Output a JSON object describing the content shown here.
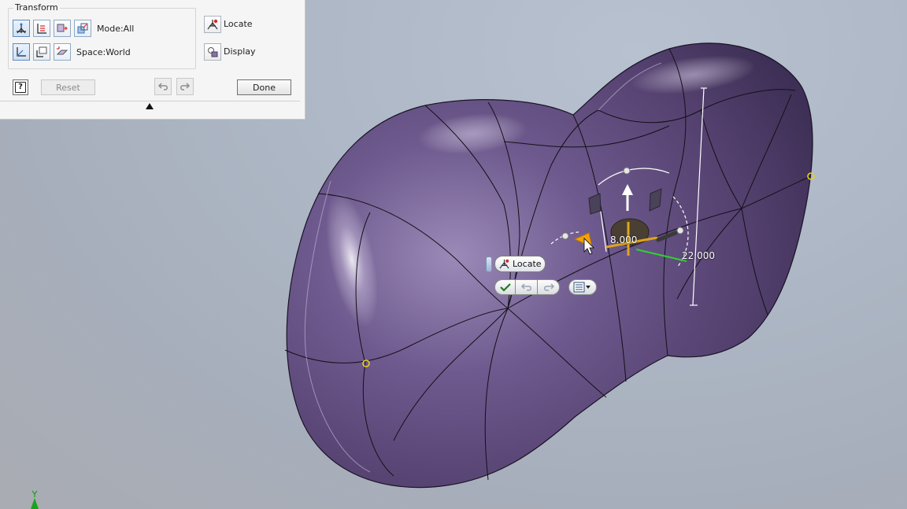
{
  "panel": {
    "group_title": "Transform",
    "mode_label": "Mode:All",
    "space_label": "Space:World",
    "locate_label": "Locate",
    "display_label": "Display",
    "reset_label": "Reset",
    "done_label": "Done",
    "icons": {
      "row1": [
        "transform-all-icon",
        "transform-axis-icon",
        "transform-planar-icon",
        "transform-scale-icon"
      ],
      "row2": [
        "space-world-icon",
        "space-view-icon",
        "space-local-icon"
      ]
    }
  },
  "minitoolbar": {
    "locate_label": "Locate",
    "icons": [
      "check-icon",
      "undo-icon",
      "redo-icon",
      "options-menu-icon"
    ]
  },
  "manipulator": {
    "length_value": "8.000",
    "offset_value": "22.000"
  },
  "axis": {
    "label": "Y",
    "color": "#1aa320"
  },
  "colors": {
    "model_fill": "#6e5a8e",
    "edge": "#111111",
    "accent": "#f2a20a",
    "axis_green": "#2fd12f"
  }
}
